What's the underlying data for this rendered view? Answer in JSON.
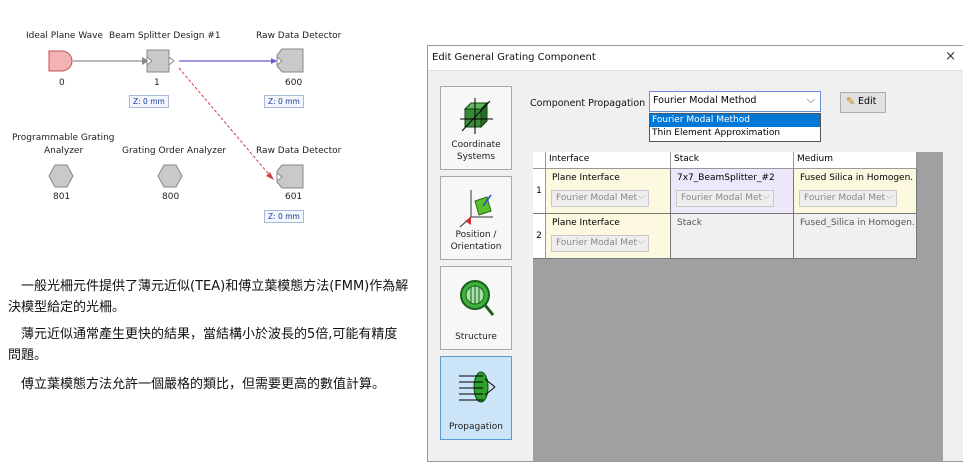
{
  "diagram": {
    "ideal_plane_wave": {
      "label": "Ideal Plane Wave",
      "id": "0"
    },
    "beam_splitter": {
      "label": "Beam Splitter Design #1",
      "id": "1",
      "tag": "Z: 0 mm"
    },
    "raw_detector_1": {
      "label": "Raw Data Detector",
      "id": "600",
      "tag": "Z: 0 mm"
    },
    "raw_detector_2": {
      "label": "Raw Data Detector",
      "id": "601",
      "tag": "Z: 0 mm"
    },
    "grating_analyzer": {
      "label_line1": "Programmable Grating",
      "label_line2": "Analyzer",
      "id": "801"
    },
    "order_analyzer": {
      "label": "Grating Order Analyzer",
      "id": "800"
    }
  },
  "description": {
    "p1": "　一般光柵元件提供了薄元近似(TEA)和傅立葉模態方法(FMM)作為解決模型給定的光柵。",
    "p2": "　薄元近似通常產生更快的結果，當結構小於波長的5倍,可能有精度問題。",
    "p3": "　傅立葉模態方法允許一個嚴格的類比，但需要更高的數值計算。"
  },
  "dialog": {
    "title": "Edit General Grating Component",
    "close": "×",
    "side_tabs": [
      {
        "line1": "Coordinate",
        "line2": "Systems"
      },
      {
        "line1": "Position /",
        "line2": "Orientation"
      },
      {
        "line1": "Structure",
        "line2": ""
      },
      {
        "line1": "Propagation",
        "line2": ""
      }
    ],
    "component_propagation_label": "Component Propagation",
    "combo_value": "Fourier Modal Method",
    "dropdown_options": [
      "Fourier Modal Method",
      "Thin Element Approximation"
    ],
    "edit_button": "Edit",
    "table": {
      "headers": [
        "Interface",
        "Stack",
        "Medium"
      ],
      "rows": [
        {
          "no": "1",
          "interface": "Plane Interface",
          "interface_method": "Fourier Modal Met",
          "stack": "7x7_BeamSplitter_#2",
          "stack_method": "Fourier Modal Met",
          "medium": "Fused Silica in Homogen...",
          "medium_method": "Fourier Modal Met"
        },
        {
          "no": "2",
          "interface": "Plane Interface",
          "interface_method": "Fourier Modal Met",
          "stack": "Stack",
          "medium": "Fused_Silica in Homogen..."
        }
      ]
    }
  }
}
